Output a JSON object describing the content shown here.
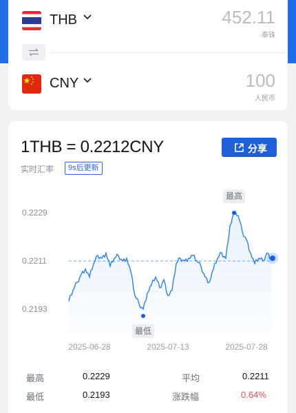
{
  "converter": {
    "from": {
      "code": "THB",
      "amount": "452.11",
      "unit": "泰铢"
    },
    "to": {
      "code": "CNY",
      "amount": "100",
      "unit": "人民币"
    },
    "swap_icon": "swap-arrows-icon"
  },
  "rate": {
    "title": "1THB = 0.2212CNY",
    "realtime_label": "实时汇率",
    "update_badge": "9s后更新",
    "share_label": "分享",
    "share_icon": "share-external-icon",
    "accent_color": "#1f5fd6"
  },
  "chart_data": {
    "type": "line",
    "title": "",
    "xlabel": "",
    "ylabel": "",
    "x_ticks": [
      "2025-06-28",
      "2025-07-13",
      "2025-07-28"
    ],
    "y_ticks": [
      0.2229,
      0.2211,
      0.2193
    ],
    "ylim": [
      0.2184,
      0.2236
    ],
    "reference_line": 0.2211,
    "max_label": "最高",
    "min_label": "最低",
    "series": [
      {
        "values": [
          0.2196,
          0.22,
          0.2203,
          0.2206,
          0.2208,
          0.2205,
          0.221,
          0.2213,
          0.2212,
          0.2214,
          0.2209,
          0.2212,
          0.2213,
          0.2211,
          0.2212,
          0.2207,
          0.2198,
          0.2195,
          0.2193,
          0.2199,
          0.2202,
          0.2205,
          0.2201,
          0.2204,
          0.2198,
          0.22,
          0.221,
          0.2212,
          0.2211,
          0.2212,
          0.2213,
          0.2211,
          0.2209,
          0.2205,
          0.2203,
          0.2208,
          0.2212,
          0.2214,
          0.2212,
          0.2224,
          0.2229,
          0.2228,
          0.2222,
          0.2219,
          0.2214,
          0.221,
          0.2212,
          0.2211,
          0.2214,
          0.2212
        ],
        "line_color": "#2a80e8"
      }
    ]
  },
  "stats": {
    "high_label": "最高",
    "high_value": "0.2229",
    "avg_label": "平均",
    "avg_value": "0.2211",
    "low_label": "最低",
    "low_value": "0.2193",
    "change_label": "涨跌幅",
    "change_value": "0.64%",
    "change_color": "#e05252"
  }
}
